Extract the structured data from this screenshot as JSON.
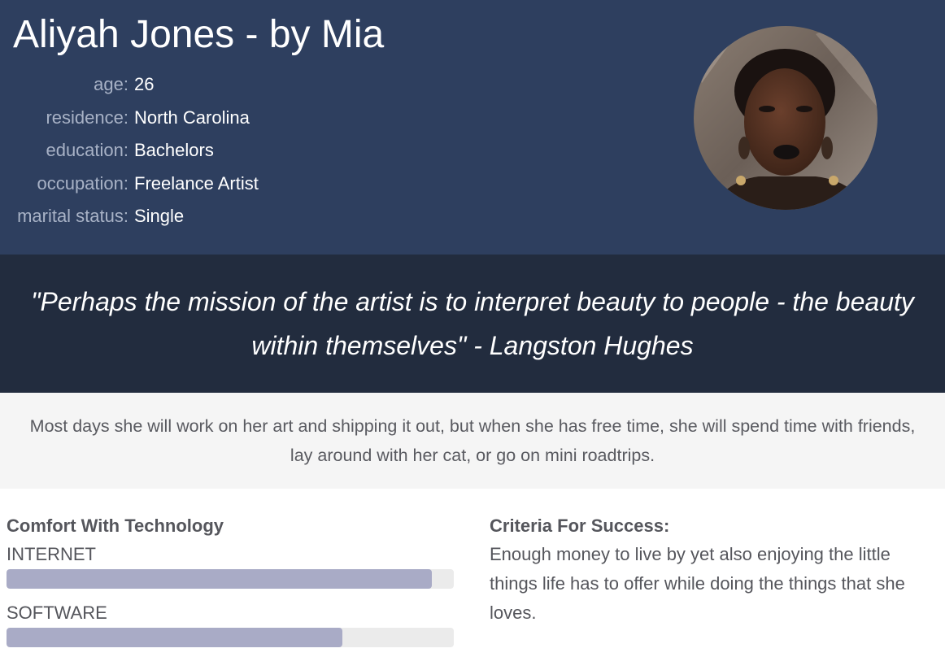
{
  "persona": {
    "title": "Aliyah Jones - by Mia",
    "facts": [
      {
        "label": "age:",
        "value": "26"
      },
      {
        "label": "residence:",
        "value": "North Carolina"
      },
      {
        "label": "education:",
        "value": "Bachelors"
      },
      {
        "label": "occupation:",
        "value": "Freelance Artist"
      },
      {
        "label": "marital status:",
        "value": "Single"
      }
    ]
  },
  "quote": "\"Perhaps the mission of the artist is to interpret beauty to people - the beauty within themselves\" - Langston Hughes",
  "bio": "Most days she will work on her art and shipping it out, but when she has free time, she will spend time with friends, lay around with her cat, or go on mini roadtrips.",
  "technology": {
    "title": "Comfort With Technology",
    "skills": [
      {
        "label": "INTERNET",
        "level_percent": 95
      },
      {
        "label": "SOFTWARE",
        "level_percent": 75
      }
    ]
  },
  "criteria": {
    "title": "Criteria For Success:",
    "body": "Enough money to live by yet also enjoying the little things life has to offer while doing the things that she loves."
  },
  "colors": {
    "header_bg": "#2e3f5f",
    "quote_bg": "#222c3e",
    "bio_bg": "#f5f5f5",
    "bar_fill": "#a9abc6",
    "bar_track": "#ebebeb"
  }
}
